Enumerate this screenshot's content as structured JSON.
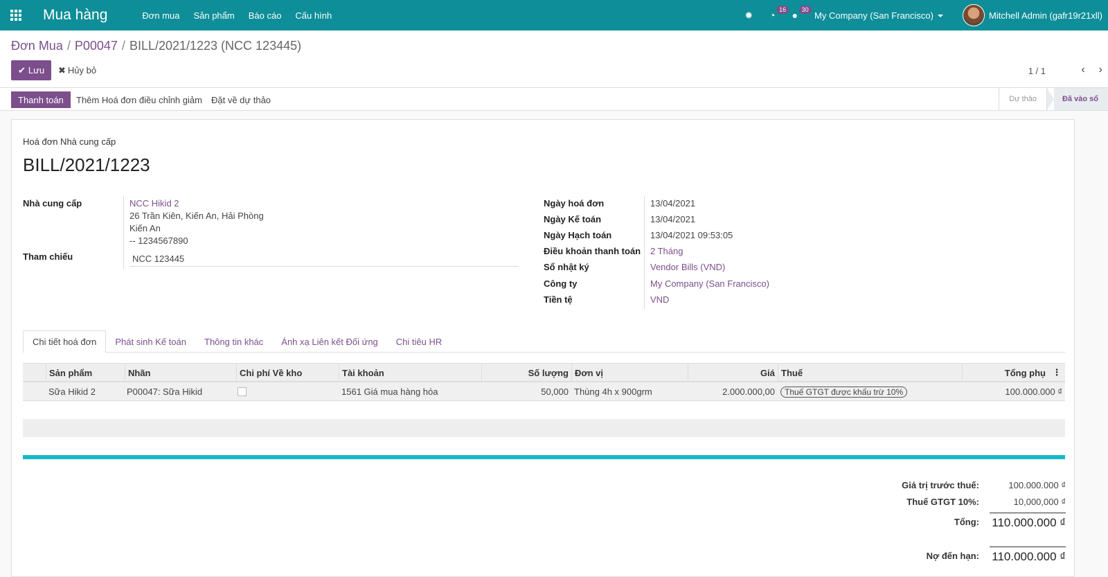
{
  "navbar": {
    "app_name": "Mua hàng",
    "menu": [
      "Đơn mua",
      "Sản phẩm",
      "Báo cáo",
      "Cấu hình"
    ],
    "activity_count": "16",
    "message_count": "30",
    "company": "My Company (San Francisco)",
    "user": "Mitchell Admin (gafr19r21xll)"
  },
  "breadcrumb": {
    "items": [
      "Đơn Mua",
      "P00047"
    ],
    "current": "BILL/2021/1223 (NCC 123445)"
  },
  "actions": {
    "save": "Lưu",
    "discard": "Hủy bỏ",
    "pager": "1 / 1"
  },
  "status_bar": {
    "pay": "Thanh toán",
    "add_credit_note": "Thêm Hoá đơn điều chỉnh giảm",
    "reset_draft": "Đặt về dự thảo",
    "stages": [
      "Dự thảo",
      "Đã vào sổ"
    ],
    "active_stage": "Đã vào sổ"
  },
  "document": {
    "kind": "Hoá đơn Nhà cung cấp",
    "title": "BILL/2021/1223"
  },
  "left_fields": {
    "vendor_label": "Nhà cung cấp",
    "vendor_name": "NCC Hikid 2",
    "vendor_street": "26 Trần Kiên, Kiến An, Hải Phòng",
    "vendor_city": "Kiến An",
    "vendor_phone": "-- 1234567890",
    "reference_label": "Tham chiếu",
    "reference_value": "NCC 123445"
  },
  "right_fields": [
    {
      "label": "Ngày hoá đơn",
      "value": "13/04/2021",
      "link": false
    },
    {
      "label": "Ngày Kế toán",
      "value": "13/04/2021",
      "link": false
    },
    {
      "label": "Ngày Hạch toán",
      "value": "13/04/2021 09:53:05",
      "link": false
    },
    {
      "label": "Điều khoản thanh toán",
      "value": "2 Tháng",
      "link": true
    },
    {
      "label": "Sổ nhật ký",
      "value": "Vendor Bills (VND)",
      "link": true
    },
    {
      "label": "Công ty",
      "value": "My Company (San Francisco)",
      "link": true
    },
    {
      "label": "Tiền tệ",
      "value": "VND",
      "link": true
    }
  ],
  "tabs": [
    "Chi tiết hoá đơn",
    "Phát sinh Kế toán",
    "Thông tin khác",
    "Ánh xạ Liên kết Đối ứng",
    "Chi tiêu HR"
  ],
  "table": {
    "headers": [
      "Sản phẩm",
      "Nhãn",
      "Chi phí Về kho",
      "Tài khoản",
      "Số lượng",
      "Đơn vị",
      "Giá",
      "Thuế",
      "Tổng phụ"
    ],
    "rows": [
      {
        "product": "Sữa Hikid 2",
        "label": "P00047: Sữa Hikid",
        "account": "1561 Giá mua hàng hóa",
        "quantity": "50,000",
        "uom": "Thùng 4h x 900grm",
        "price": "2.000.000,00",
        "tax": "Thuế GTGT được khấu trừ 10%",
        "subtotal": "100.000.000 ₫"
      }
    ]
  },
  "totals": {
    "untaxed_label": "Giá trị trước thuế:",
    "untaxed_value": "100.000.000 ₫",
    "tax_label": "Thuế GTGT 10%:",
    "tax_value": "10,000,000 ₫",
    "total_label": "Tổng:",
    "total_value": "110.000.000 ₫",
    "due_label": "Nợ đến hạn:",
    "due_value": "110.000.000 ₫"
  },
  "colors": {
    "navbar": "#0d8e98",
    "primary": "#7c4f8c",
    "accent_line": "#17b8c8"
  }
}
